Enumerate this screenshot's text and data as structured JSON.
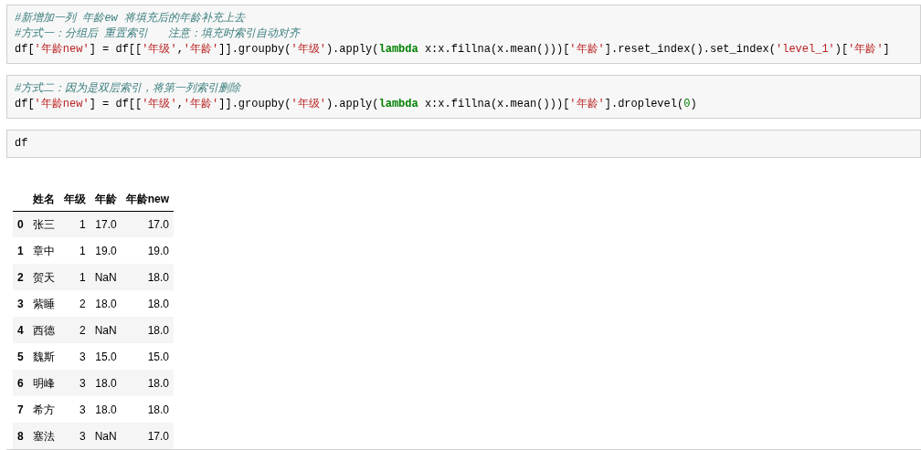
{
  "cells": [
    {
      "lines": [
        [
          {
            "kind": "comment",
            "text": "#新增加一列 年龄ew 将填充后的年龄补充上去"
          }
        ],
        [
          {
            "kind": "comment",
            "text": "#方式一：分组后 重置索引   注意：填充时索引自动对齐"
          }
        ],
        [
          {
            "kind": "plain",
            "text": "df["
          },
          {
            "kind": "string",
            "text": "'年龄new'"
          },
          {
            "kind": "plain",
            "text": "] = df[["
          },
          {
            "kind": "string",
            "text": "'年级'"
          },
          {
            "kind": "plain",
            "text": ","
          },
          {
            "kind": "string",
            "text": "'年龄'"
          },
          {
            "kind": "plain",
            "text": "]].groupby("
          },
          {
            "kind": "string",
            "text": "'年级'"
          },
          {
            "kind": "plain",
            "text": ").apply("
          },
          {
            "kind": "keyword",
            "text": "lambda"
          },
          {
            "kind": "plain",
            "text": " x:x.fillna(x.mean()))["
          },
          {
            "kind": "string",
            "text": "'年龄'"
          },
          {
            "kind": "plain",
            "text": "].reset_index().set_index("
          },
          {
            "kind": "string",
            "text": "'level_1'"
          },
          {
            "kind": "plain",
            "text": ")["
          },
          {
            "kind": "string",
            "text": "'年龄'"
          },
          {
            "kind": "plain",
            "text": "]"
          }
        ]
      ]
    },
    {
      "lines": [
        [
          {
            "kind": "comment",
            "text": "#方式二：因为是双层索引，将第一列索引删除"
          }
        ],
        [
          {
            "kind": "plain",
            "text": "df["
          },
          {
            "kind": "string",
            "text": "'年龄new'"
          },
          {
            "kind": "plain",
            "text": "] = df[["
          },
          {
            "kind": "string",
            "text": "'年级'"
          },
          {
            "kind": "plain",
            "text": ","
          },
          {
            "kind": "string",
            "text": "'年龄'"
          },
          {
            "kind": "plain",
            "text": "]].groupby("
          },
          {
            "kind": "string",
            "text": "'年级'"
          },
          {
            "kind": "plain",
            "text": ").apply("
          },
          {
            "kind": "keyword",
            "text": "lambda"
          },
          {
            "kind": "plain",
            "text": " x:x.fillna(x.mean()))["
          },
          {
            "kind": "string",
            "text": "'年龄'"
          },
          {
            "kind": "plain",
            "text": "].droplevel("
          },
          {
            "kind": "number",
            "text": "0"
          },
          {
            "kind": "plain",
            "text": ")"
          }
        ]
      ]
    },
    {
      "lines": [
        [
          {
            "kind": "plain",
            "text": "df"
          }
        ]
      ]
    }
  ],
  "table": {
    "columns": [
      "",
      "姓名",
      "年级",
      "年龄",
      "年龄new"
    ],
    "rows": [
      [
        "0",
        "张三",
        "1",
        "17.0",
        "17.0"
      ],
      [
        "1",
        "章中",
        "1",
        "19.0",
        "19.0"
      ],
      [
        "2",
        "贺天",
        "1",
        "NaN",
        "18.0"
      ],
      [
        "3",
        "紫睡",
        "2",
        "18.0",
        "18.0"
      ],
      [
        "4",
        "西德",
        "2",
        "NaN",
        "18.0"
      ],
      [
        "5",
        "魏斯",
        "3",
        "15.0",
        "15.0"
      ],
      [
        "6",
        "明峰",
        "3",
        "18.0",
        "18.0"
      ],
      [
        "7",
        "希方",
        "3",
        "18.0",
        "18.0"
      ],
      [
        "8",
        "塞法",
        "3",
        "NaN",
        "17.0"
      ]
    ]
  }
}
